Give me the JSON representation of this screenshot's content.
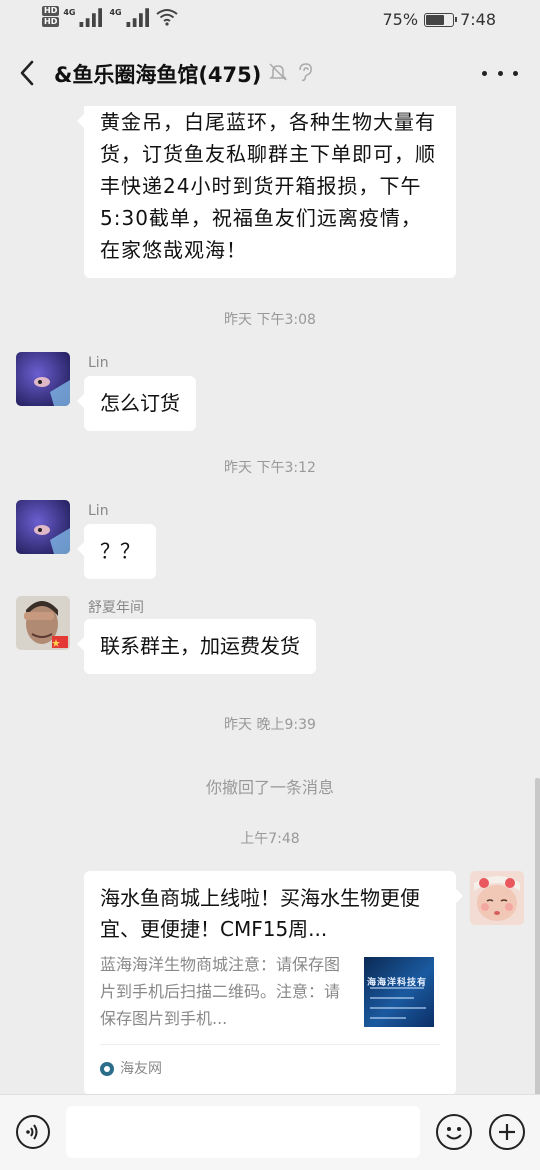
{
  "status_bar": {
    "network_left_top": "HD",
    "network_left_bottom": "HD",
    "sim1_label": "4G",
    "sim2_label": "4G",
    "battery_level_percent": 75,
    "battery_text": "75%",
    "time": "7:48"
  },
  "header": {
    "title": "&鱼乐圈海鱼馆(475)",
    "icons": [
      "bell-muted-icon",
      "ear-icon"
    ]
  },
  "messages": {
    "m1_text": "黄金吊，白尾蓝环，各种生物大量有货，订货鱼友私聊群主下单即可，顺丰快递24小时到货开箱报损，下午5:30截单，祝福鱼友们远离疫情，在家悠哉观海！",
    "t1": "昨天 下午3:08",
    "m2_sender": "Lin",
    "m2_text": "怎么订货",
    "t2": "昨天 下午3:12",
    "m3_sender": "Lin",
    "m3_text": "？？",
    "m4_sender": "舒夏年间",
    "m4_text": "联系群主，加运费发货",
    "t3": "昨天 晚上9:39",
    "recall_notice": "你撤回了一条消息",
    "t4": "上午7:48",
    "card": {
      "title": "海水鱼商城上线啦！买海水生物更便宜、更便捷！CMF15周...",
      "description": "蓝海海洋生物商城注意：请保存图片到手机后扫描二维码。注意：请保存图片到手机...",
      "thumb_text": "海海洋科技有",
      "source": "海友网"
    }
  },
  "input_bar": {
    "placeholder": ""
  },
  "colors": {
    "background": "#ededed",
    "bubble": "#ffffff",
    "timestamp": "#999999"
  }
}
